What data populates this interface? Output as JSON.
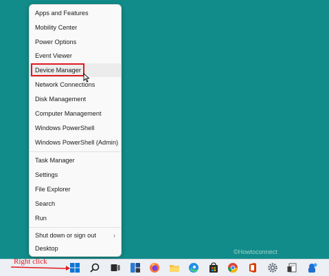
{
  "context_menu": {
    "group1": [
      "Apps and Features",
      "Mobility Center",
      "Power Options",
      "Event Viewer",
      "Device Manager",
      "Network Connections",
      "Disk Management",
      "Computer Management",
      "Windows PowerShell",
      "Windows PowerShell (Admin)"
    ],
    "group2": [
      "Task Manager",
      "Settings",
      "File Explorer",
      "Search",
      "Run"
    ],
    "group3": [
      "Shut down or sign out",
      "Desktop"
    ],
    "submenu_chevron": "›",
    "highlighted_item": "Device Manager"
  },
  "annotation": {
    "label": "Right click",
    "color": "#e0191e"
  },
  "watermark": "©Howtoconnect",
  "colors": {
    "desktop": "#128c8a",
    "taskbar": "#eceff3",
    "highlight_border": "#e0191e"
  },
  "taskbar_icons": [
    "start-icon",
    "search-icon",
    "task-view-icon",
    "widgets-icon",
    "firefox-icon",
    "file-explorer-icon",
    "edge-icon",
    "store-icon",
    "chrome-icon",
    "office-icon",
    "settings-icon",
    "notepad-icon",
    "app-icon"
  ]
}
